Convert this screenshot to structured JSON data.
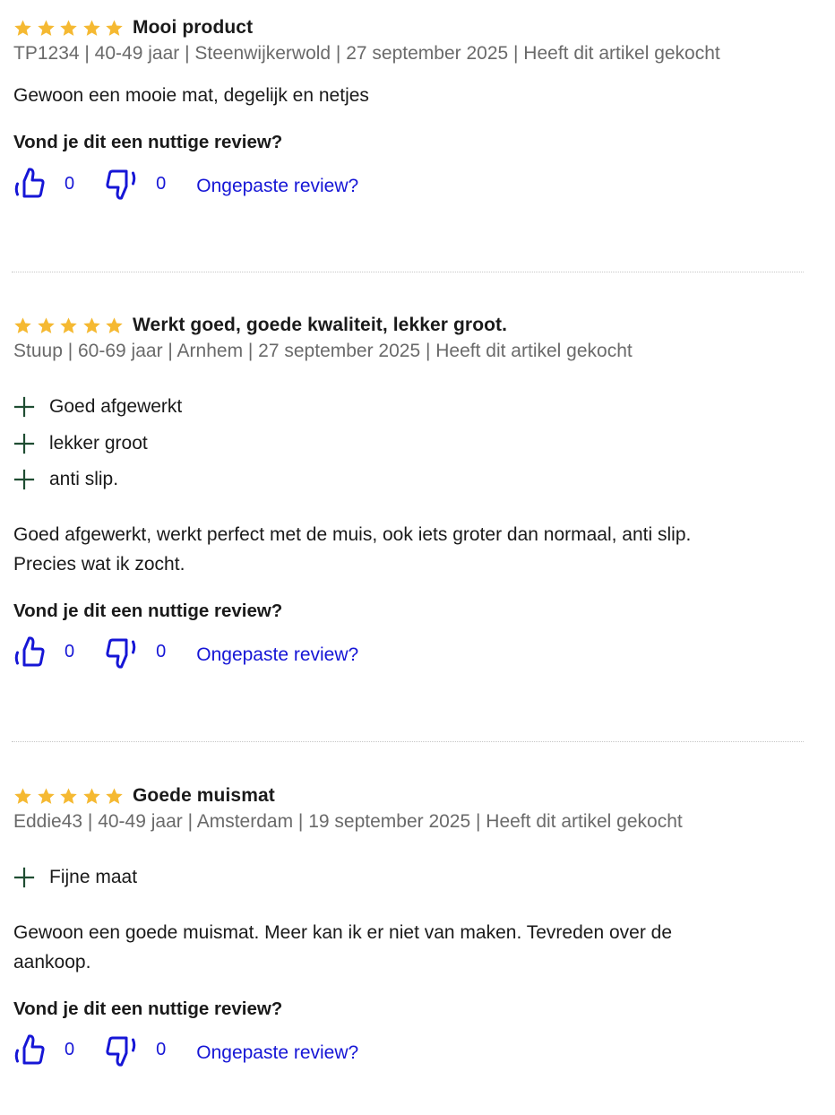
{
  "colors": {
    "star": "#f5b932",
    "plus": "#1f4d32",
    "link": "#1616d6",
    "meta": "#6a6a6a"
  },
  "icons": {
    "rating": "star-icon",
    "pro": "plus-icon",
    "vote_up": "thumbs-up-icon",
    "vote_down": "thumbs-down-icon"
  },
  "reviews": [
    {
      "rating": 5,
      "title": "Mooi product",
      "meta": "TP1234 | 40-49 jaar | Steenwijkerwold | 27 september 2025 | Heeft dit artikel gekocht",
      "pros": [],
      "text": "Gewoon een mooie mat, degelijk en netjes",
      "helpful_question": "Vond je dit een nuttige review?",
      "upvotes": "0",
      "downvotes": "0",
      "report_label": "Ongepaste review?"
    },
    {
      "rating": 5,
      "title": "Werkt goed, goede kwaliteit, lekker groot.",
      "meta": "Stuup | 60-69 jaar | Arnhem | 27 september 2025 | Heeft dit artikel gekocht",
      "pros": [
        "Goed afgewerkt",
        "lekker groot",
        "anti slip."
      ],
      "text_lines": [
        "Goed afgewerkt, werkt perfect met de muis, ook iets groter dan normaal, anti slip.",
        "Precies wat ik zocht."
      ],
      "helpful_question": "Vond je dit een nuttige review?",
      "upvotes": "0",
      "downvotes": "0",
      "report_label": "Ongepaste review?"
    },
    {
      "rating": 5,
      "title": "Goede muismat",
      "meta": "Eddie43 | 40-49 jaar | Amsterdam | 19 september 2025 | Heeft dit artikel gekocht",
      "pros": [
        "Fijne maat"
      ],
      "text_lines": [
        "Gewoon een goede muismat. Meer kan ik er niet van maken. Tevreden over de",
        "aankoop."
      ],
      "helpful_question": "Vond je dit een nuttige review?",
      "upvotes": "0",
      "downvotes": "0",
      "report_label": "Ongepaste review?"
    }
  ]
}
